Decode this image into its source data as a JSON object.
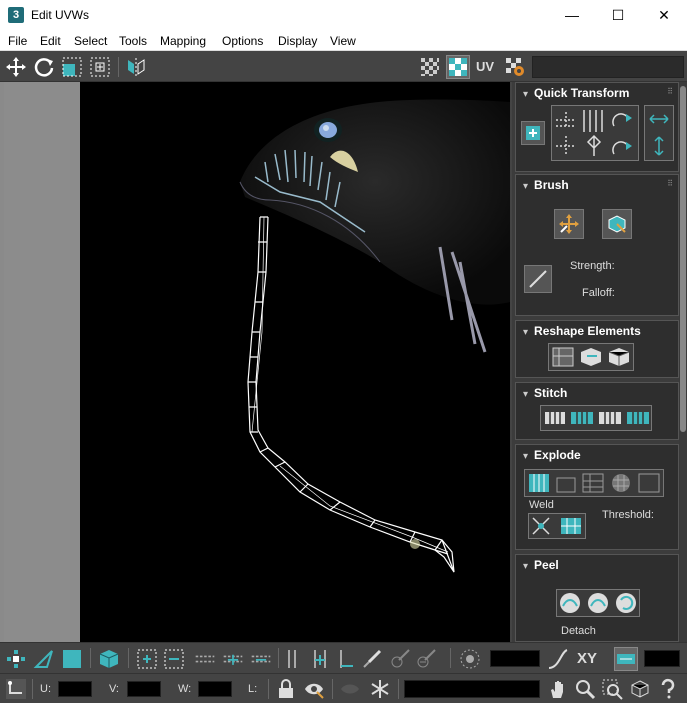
{
  "window": {
    "app_icon_text": "3",
    "title": "Edit UVWs",
    "minimize": "—",
    "maximize": "☐",
    "close": "✕"
  },
  "menu": [
    "File",
    "Edit",
    "Select",
    "Tools",
    "Mapping",
    "Options",
    "Display",
    "View"
  ],
  "toolbar": {
    "uv_label": "UV"
  },
  "panels": {
    "quick_transform": {
      "title": "Quick Transform"
    },
    "brush": {
      "title": "Brush",
      "strength_label": "Strength:",
      "falloff_label": "Falloff:"
    },
    "reshape": {
      "title": "Reshape Elements"
    },
    "stitch": {
      "title": "Stitch"
    },
    "explode": {
      "title": "Explode",
      "weld_label": "Weld",
      "threshold_label": "Threshold:"
    },
    "peel": {
      "title": "Peel",
      "detach_label": "Detach"
    }
  },
  "statusbar": {
    "xy_label": "XY",
    "u_label": "U:",
    "v_label": "V:",
    "w_label": "W:",
    "l_label": "L:"
  },
  "colors": {
    "accent": "#3fb6bd",
    "background": "#444444",
    "viewport": "#000000"
  }
}
